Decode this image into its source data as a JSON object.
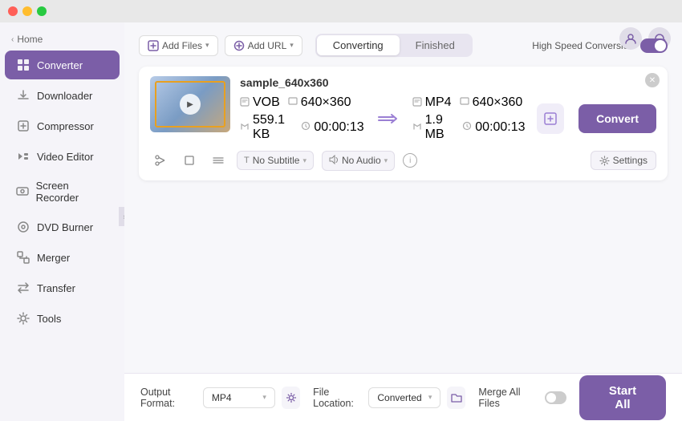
{
  "titlebar": {
    "traffic_lights": [
      "red",
      "yellow",
      "green"
    ]
  },
  "sidebar": {
    "home_label": "Home",
    "items": [
      {
        "id": "converter",
        "label": "Converter",
        "icon": "⊞",
        "active": true
      },
      {
        "id": "downloader",
        "label": "Downloader",
        "icon": "⬇",
        "active": false
      },
      {
        "id": "compressor",
        "label": "Compressor",
        "icon": "⊡",
        "active": false
      },
      {
        "id": "video-editor",
        "label": "Video Editor",
        "icon": "✂",
        "active": false
      },
      {
        "id": "screen-recorder",
        "label": "Screen Recorder",
        "icon": "▣",
        "active": false
      },
      {
        "id": "dvd-burner",
        "label": "DVD Burner",
        "icon": "◎",
        "active": false
      },
      {
        "id": "merger",
        "label": "Merger",
        "icon": "⊞",
        "active": false
      },
      {
        "id": "transfer",
        "label": "Transfer",
        "icon": "⇄",
        "active": false
      },
      {
        "id": "tools",
        "label": "Tools",
        "icon": "⚙",
        "active": false
      }
    ]
  },
  "topbar": {
    "add_file_label": "Add Files",
    "add_file_chevron": "▾",
    "add_url_label": "Add URL",
    "add_url_chevron": "▾",
    "tabs": [
      {
        "id": "converting",
        "label": "Converting",
        "active": true
      },
      {
        "id": "finished",
        "label": "Finished",
        "active": false
      }
    ],
    "speed_label": "High Speed Conversion",
    "speed_enabled": true
  },
  "file_card": {
    "filename": "sample_640x360",
    "source": {
      "format": "VOB",
      "resolution": "640×360",
      "size": "559.1 KB",
      "duration": "00:00:13"
    },
    "target": {
      "format": "MP4",
      "resolution": "640×360",
      "size": "1.9 MB",
      "duration": "00:00:13"
    },
    "subtitle_label": "No Subtitle",
    "audio_label": "No Audio",
    "settings_label": "Settings",
    "convert_label": "Convert",
    "close_icon": "✕"
  },
  "bottom_bar": {
    "output_format_label": "Output Format:",
    "output_format_value": "MP4",
    "file_location_label": "File Location:",
    "file_location_value": "Converted",
    "merge_label": "Merge All Files",
    "merge_enabled": false,
    "start_all_label": "Start All"
  },
  "icons": {
    "user": "👤",
    "headphones": "🎧",
    "scissors": "✂",
    "crop": "⊡",
    "settings": "⚙",
    "info": "i",
    "play": "▶",
    "folder": "📁",
    "clock": "🕐",
    "file": "📄",
    "hw": "⚡",
    "subtitle": "T",
    "audio_wave": "♫",
    "chevron_left": "‹",
    "gear": "⚙",
    "add_file": "📄",
    "add_url": "🔗"
  }
}
